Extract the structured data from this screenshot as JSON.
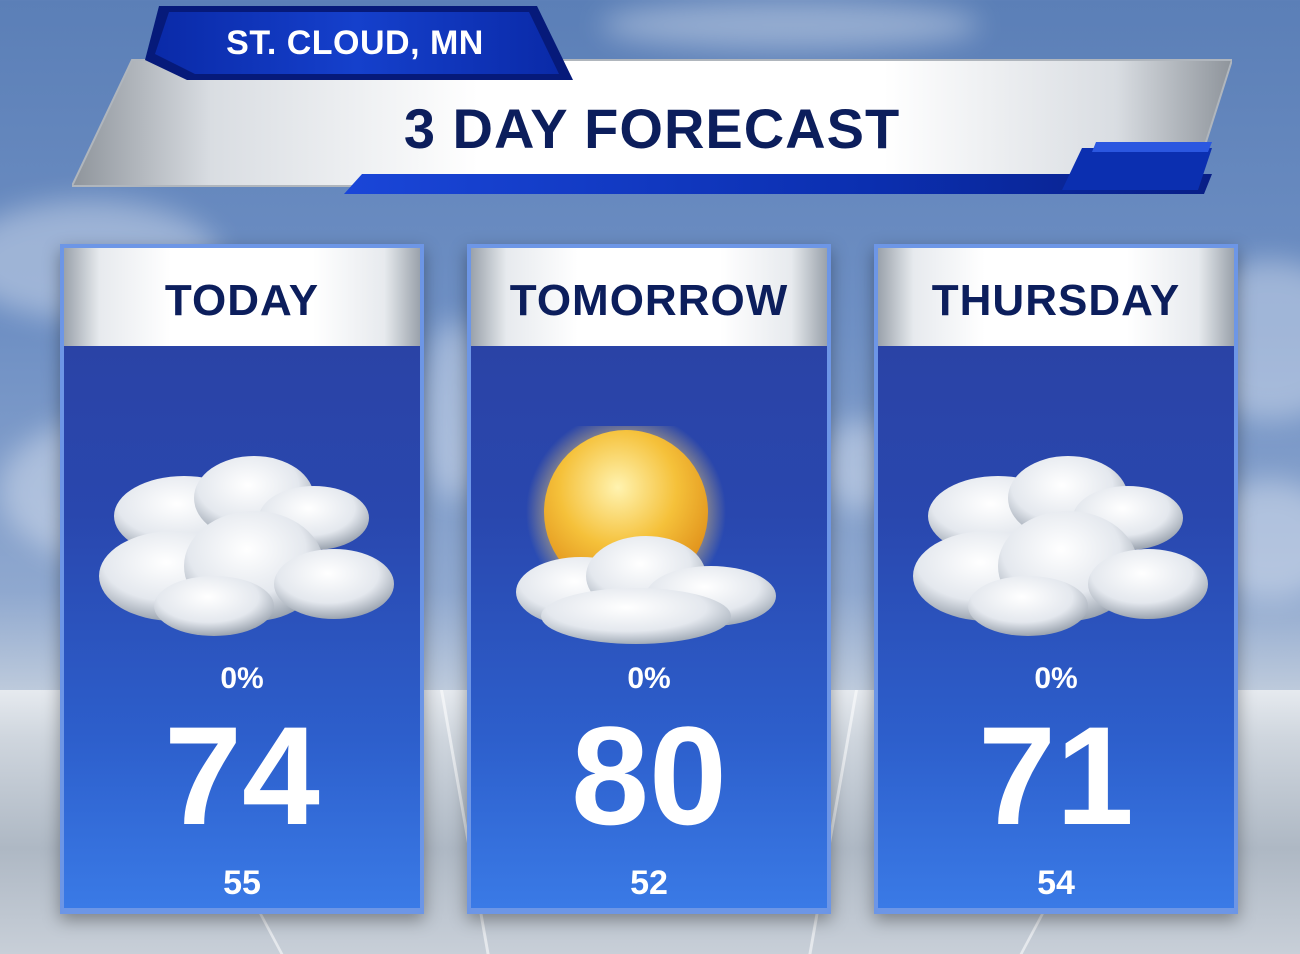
{
  "header": {
    "location": "ST. CLOUD, MN",
    "title": "3 DAY FORECAST"
  },
  "colors": {
    "navy_text": "#0c1e5c",
    "card_blue": "#2a43a6",
    "accent_blue": "#0b2fb0"
  },
  "days": [
    {
      "label": "TODAY",
      "icon": "cloudy-icon",
      "precip": "0%",
      "high": "74",
      "low": "55"
    },
    {
      "label": "TOMORROW",
      "icon": "partly-sunny-icon",
      "precip": "0%",
      "high": "80",
      "low": "52"
    },
    {
      "label": "THURSDAY",
      "icon": "cloudy-icon",
      "precip": "0%",
      "high": "71",
      "low": "54"
    }
  ]
}
